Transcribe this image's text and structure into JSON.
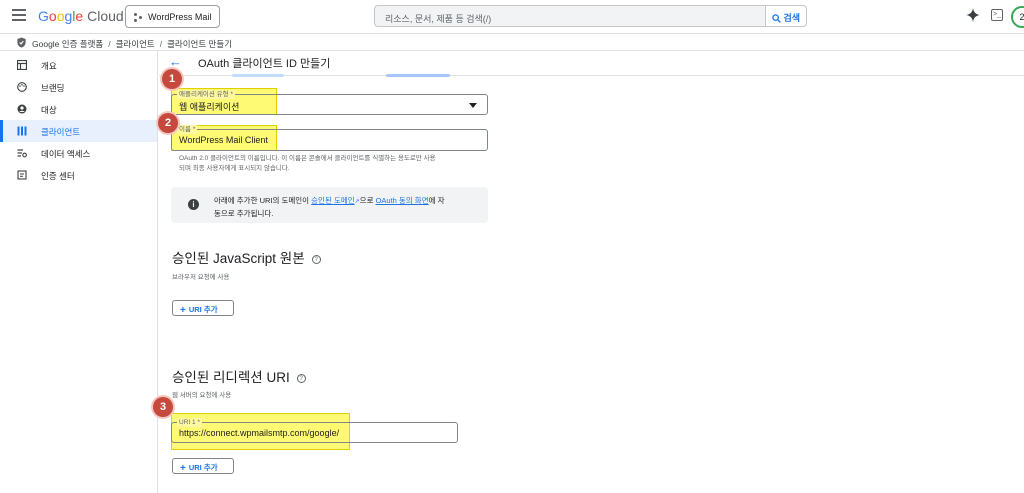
{
  "header": {
    "logo_google": "Google",
    "logo_cloud": "Cloud",
    "project_name": "WordPress Mail",
    "search_placeholder": "리소스, 문서, 제품 등 검색(/)",
    "search_button": "검색",
    "terminal_glyph": ">_",
    "avatar_letter": "2"
  },
  "breadcrumb": {
    "items": [
      "Google 인증 플랫폼",
      "클라이언트",
      "클라이언트 만들기"
    ],
    "separator": "/"
  },
  "sidebar": {
    "items": [
      {
        "label": "개요",
        "icon": "dashboard-icon",
        "active": false
      },
      {
        "label": "브랜딩",
        "icon": "palette-icon",
        "active": false
      },
      {
        "label": "대상",
        "icon": "person-icon",
        "active": false
      },
      {
        "label": "클라이언트",
        "icon": "key-icon",
        "active": true
      },
      {
        "label": "데이터 액세스",
        "icon": "settings-list-icon",
        "active": false
      },
      {
        "label": "인증 센터",
        "icon": "verified-icon",
        "active": false
      }
    ]
  },
  "main": {
    "title": "OAuth 클라이언트 ID 만들기",
    "app_type": {
      "label": "애플리케이션 유형 *",
      "value": "웹 애플리케이션"
    },
    "name": {
      "label": "이름 *",
      "value": "WordPress Mail Client",
      "helper_line1": "OAuth 2.0 클라이언트의 이름입니다. 이 이름은 콘솔에서 클라이언트를 식별하는 용도로만 사용",
      "helper_line2": "되며 최종 사용자에게 표시되지 않습니다."
    },
    "info": {
      "text_before": "아래에 추가한 URI의 도메인이 ",
      "link1": "승인된 도메인",
      "text_middle": "으로 ",
      "link2": "OAuth 동의 화면",
      "text_after": "에 자",
      "text_line2": "동으로 추가됩니다."
    },
    "js_origins": {
      "title": "승인된 JavaScript 원본",
      "subtitle": "브라우저 요청에 사용",
      "button": "URI 추가"
    },
    "redirect_uris": {
      "title": "승인된 리디렉션 URI",
      "subtitle": "웹 서버의 요청에 사용",
      "uri_label": "URI 1 *",
      "uri_value": "https://connect.wpmailsmtp.com/google/",
      "button": "URI 추가"
    }
  },
  "annotations": {
    "badges": [
      "1",
      "2",
      "3"
    ],
    "badge_color": "#c5493d",
    "highlight_color": "#fff500"
  },
  "colors": {
    "accent": "#1a73e8",
    "active_bg": "#e8f0fe"
  }
}
